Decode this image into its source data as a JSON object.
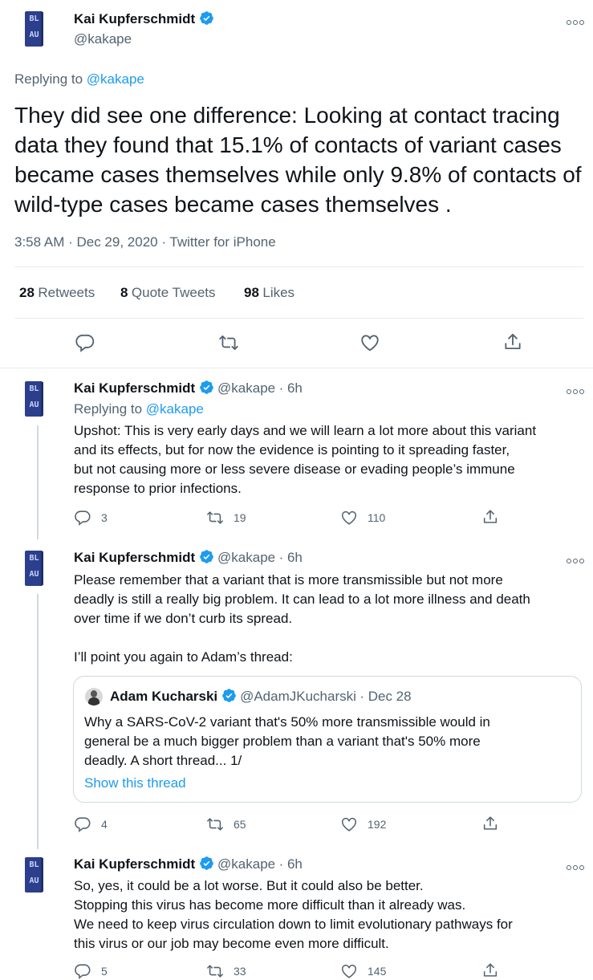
{
  "colors": {
    "accent": "#1d9bf0",
    "secondary_text": "#536471",
    "avatar_book": "#2b3f8c"
  },
  "main_tweet": {
    "author_name": "Kai Kupferschmidt",
    "author_handle": "@kakape",
    "replying_label": "Replying to",
    "replying_handle": "@kakape",
    "text": "They did see one difference: Looking at contact tracing data they found that 15.1% of contacts of variant cases became cases themselves while only 9.8% of contacts of wild-type cases became cases themselves .",
    "timestamp": "3:58 AM · Dec 29, 2020 · Twitter for iPhone",
    "stats": {
      "retweets_count": "28",
      "retweets_label": "Retweets",
      "quotes_count": "8",
      "quotes_label": "Quote Tweets",
      "likes_count": "98",
      "likes_label": "Likes"
    },
    "actions": [
      "reply-icon",
      "retweet-icon",
      "like-icon",
      "share-icon"
    ]
  },
  "avatar_letters": {
    "top": "BL",
    "bottom": "AU"
  },
  "replies": [
    {
      "author_name": "Kai Kupferschmidt",
      "author_handle": "@kakape",
      "age": "· 6h",
      "replying_label": "Replying to",
      "replying_handle": "@kakape",
      "text": "Upshot: This is very early days and we will learn a lot more about this variant\nand its effects, but for now the evidence is pointing to it spreading faster,\nbut not causing more or less severe disease or evading people’s immune\nresponse to prior infections.",
      "reply_count": "3",
      "retweet_count": "19",
      "like_count": "110"
    },
    {
      "author_name": "Kai Kupferschmidt",
      "author_handle": "@kakape",
      "age": "· 6h",
      "text": "Please remember that a variant that is more transmissible but not more\ndeadly is still a really big problem. It can lead to a lot more illness and death\nover time if we don’t curb its spread.\n\nI’ll point you again to Adam’s thread:",
      "quote": {
        "author_name": "Adam Kucharski",
        "author_handle": "@AdamJKucharski",
        "date": "· Dec 28",
        "text": "Why a SARS-CoV-2 variant that's 50% more transmissible would in\ngeneral be a much bigger problem than a variant that's 50% more\ndeadly. A short thread... 1/",
        "show_thread": "Show this thread"
      },
      "reply_count": "4",
      "retweet_count": "65",
      "like_count": "192"
    },
    {
      "author_name": "Kai Kupferschmidt",
      "author_handle": "@kakape",
      "age": "· 6h",
      "text": "So, yes, it could be a lot worse. But it could also be better.\nStopping this virus has become more difficult than it already was.\nWe need to keep virus circulation down to limit evolutionary pathways for\nthis virus or our job may become even more difficult.",
      "reply_count": "5",
      "retweet_count": "33",
      "like_count": "145"
    }
  ]
}
